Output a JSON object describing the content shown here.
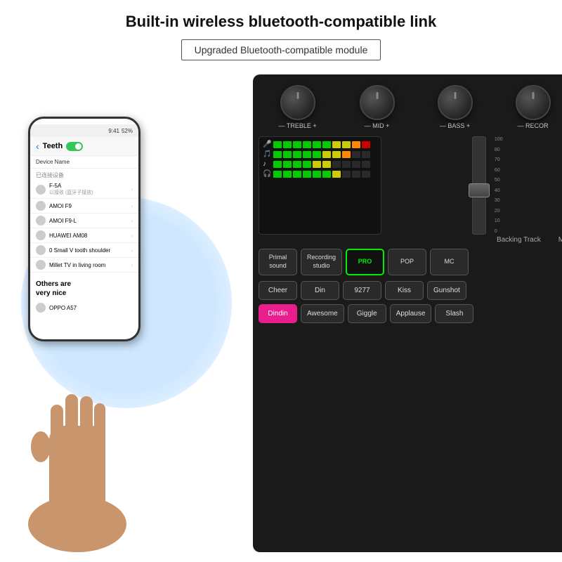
{
  "header": {
    "title": "Built-in wireless bluetooth-compatible link",
    "badge": "Upgraded Bluetooth-compatible module"
  },
  "phone": {
    "statusBar": "9:41 52%",
    "backLabel": "<",
    "screenTitle": "Teeth",
    "deviceNameLabel": "Device Name",
    "sectionLabel": "已连接设备",
    "devices": [
      {
        "name": "F-5A",
        "sub": "以接收 (蓝牙子接放)",
        "connected": true
      },
      {
        "name": "AMOI F9",
        "sub": "",
        "connected": false
      },
      {
        "name": "AMOI F9-L",
        "sub": "",
        "connected": false
      },
      {
        "name": "HUAWEI AM08",
        "sub": "",
        "connected": false
      },
      {
        "name": "0 Small V tooth shoulder",
        "sub": "",
        "connected": false
      },
      {
        "name": "Millet TV in living room",
        "sub": "",
        "connected": false
      }
    ],
    "othersLabel": "Others are\nvery nice",
    "otherDevice": "OPPO A57"
  },
  "mixer": {
    "knobs": [
      {
        "label": "— TREBLE +"
      },
      {
        "label": "— MID +"
      },
      {
        "label": "— BASS +"
      },
      {
        "label": "— RECOR"
      }
    ],
    "faderScale": [
      "100",
      "80",
      "70",
      "60",
      "50",
      "40",
      "30",
      "20",
      "10",
      "0"
    ],
    "backingTrackLabel": "Backing Track",
    "monitorLabel": "Mor",
    "soundButtons": [
      {
        "label": "Primal\nsound",
        "state": "normal"
      },
      {
        "label": "Recording\nstudio",
        "state": "normal"
      },
      {
        "label": "PRO",
        "state": "active-green"
      },
      {
        "label": "POP",
        "state": "normal"
      },
      {
        "label": "MC",
        "state": "normal"
      }
    ],
    "effectButtons1": [
      {
        "label": "Cheer",
        "state": "normal"
      },
      {
        "label": "Din",
        "state": "normal"
      },
      {
        "label": "9277",
        "state": "normal"
      },
      {
        "label": "Kiss",
        "state": "normal"
      },
      {
        "label": "Gunshot",
        "state": "normal"
      }
    ],
    "effectButtons2": [
      {
        "label": "Dindin",
        "state": "pink"
      },
      {
        "label": "Awesome",
        "state": "normal"
      },
      {
        "label": "Giggle",
        "state": "normal"
      },
      {
        "label": "Applause",
        "state": "normal"
      },
      {
        "label": "Slash",
        "state": "normal"
      }
    ]
  },
  "colors": {
    "accent_green": "#00ee00",
    "accent_pink": "#e91e8c",
    "bg_dark": "#1a1a1a",
    "bg_white": "#ffffff"
  }
}
